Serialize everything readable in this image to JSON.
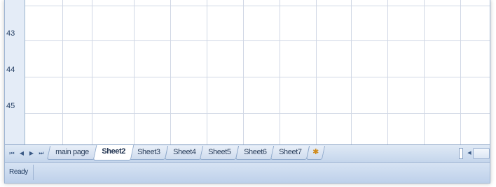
{
  "grid": {
    "rows": [
      {
        "label": "43"
      },
      {
        "label": "44"
      },
      {
        "label": "45"
      }
    ]
  },
  "sheet_nav": {
    "first_icon": "first-sheet-icon",
    "prev_icon": "prev-sheet-icon",
    "next_icon": "next-sheet-icon",
    "last_icon": "last-sheet-icon",
    "first_glyph": "⏮",
    "prev_glyph": "◀",
    "next_glyph": "▶",
    "last_glyph": "⏭"
  },
  "tabs": [
    {
      "label": "main page",
      "active": false
    },
    {
      "label": "Sheet2",
      "active": true
    },
    {
      "label": "Sheet3",
      "active": false
    },
    {
      "label": "Sheet4",
      "active": false
    },
    {
      "label": "Sheet5",
      "active": false
    },
    {
      "label": "Sheet6",
      "active": false
    },
    {
      "label": "Sheet7",
      "active": false
    }
  ],
  "insert_tab": {
    "icon": "insert-worksheet-icon",
    "glyph": "✱"
  },
  "hscroll": {
    "left_glyph": "◀"
  },
  "status": {
    "text": "Ready"
  },
  "colors": {
    "accent": "#9eb6ce",
    "tab_active_bg": "#ffffff",
    "status_bg": "#c8d8ee"
  }
}
